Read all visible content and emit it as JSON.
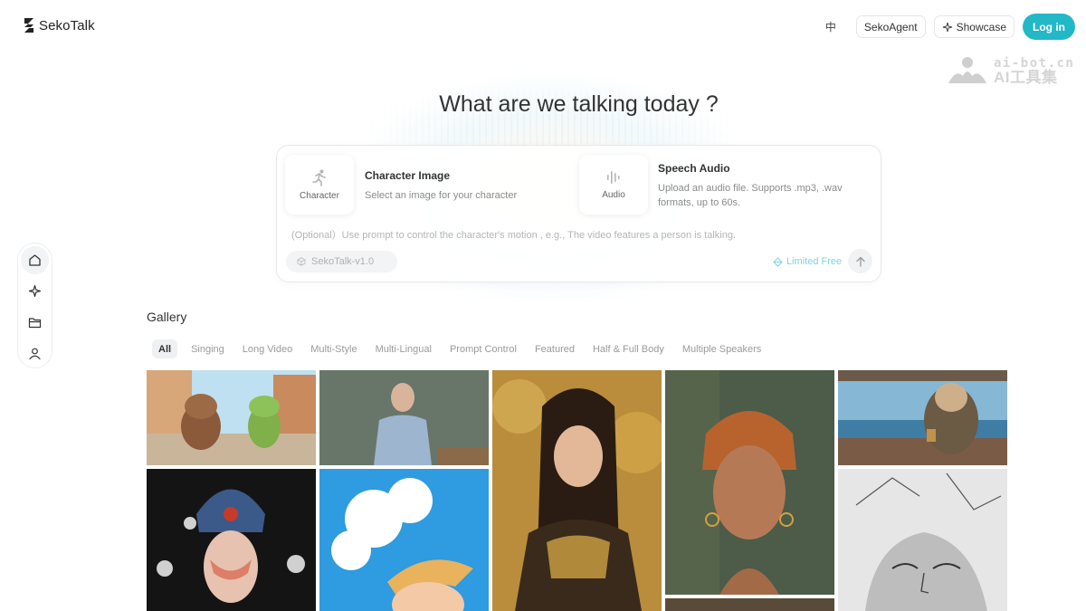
{
  "app": {
    "name": "SekoTalk"
  },
  "header": {
    "lang_label": "中",
    "agent_label": "SekoAgent",
    "showcase_label": "Showcase",
    "login_label": "Log in"
  },
  "watermark": {
    "line1": "ai-bot.cn",
    "line2": "AI工具集"
  },
  "hero": {
    "title": "What are we talking today ?"
  },
  "composer": {
    "character": {
      "tile_label": "Character",
      "title": "Character Image",
      "desc": "Select an image for your character"
    },
    "audio": {
      "tile_label": "Audio",
      "title": "Speech Audio",
      "desc_line1": "Upload an audio file. Supports .mp3, .wav",
      "desc_line2": "formats, up to 60s."
    },
    "prompt_placeholder": "(Optional）Use prompt to control the character's motion , e.g., The video features a person is talking.",
    "model": "SekoTalk-v1.0",
    "free_tag": "Limited Free"
  },
  "gallery": {
    "title": "Gallery",
    "filters": [
      "All",
      "Singing",
      "Long Video",
      "Multi-Style",
      "Multi-Lingual",
      "Prompt Control",
      "Featured",
      "Half & Full Body",
      "Multiple Speakers"
    ],
    "active_filter": "All"
  },
  "icons": {
    "rail": [
      "home-icon",
      "sparkle-icon",
      "folder-icon",
      "user-icon"
    ]
  },
  "colors": {
    "accent": "#22b8c8",
    "free_tag": "#7fd3de"
  }
}
